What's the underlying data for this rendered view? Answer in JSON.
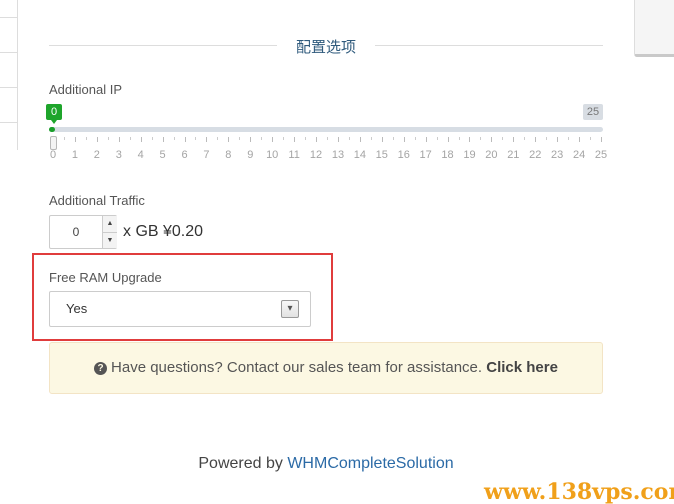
{
  "section": {
    "title": "配置选项"
  },
  "additional_ip": {
    "label": "Additional IP",
    "min_label": "0",
    "max_label": "25",
    "value_fraction": 0,
    "ticks": [
      "0",
      "1",
      "2",
      "3",
      "4",
      "5",
      "6",
      "7",
      "8",
      "9",
      "10",
      "11",
      "12",
      "13",
      "14",
      "15",
      "16",
      "17",
      "18",
      "19",
      "20",
      "21",
      "22",
      "23",
      "24",
      "25"
    ]
  },
  "additional_traffic": {
    "label": "Additional Traffic",
    "value": "0",
    "suffix": "x GB ¥0.20"
  },
  "free_ram": {
    "label": "Free RAM Upgrade",
    "selected": "Yes"
  },
  "help": {
    "text": "Have questions? Contact our sales team for assistance.",
    "link": "Click here"
  },
  "footer": {
    "prefix": "Powered by",
    "brand": "WHMCompleteSolution"
  },
  "watermark": "www.138vps.com",
  "colors": {
    "accent_green": "#1ea52b",
    "highlight_red": "#e03c3c",
    "help_bg": "#fcf8e3",
    "brand_blue": "#2b6aa6"
  }
}
